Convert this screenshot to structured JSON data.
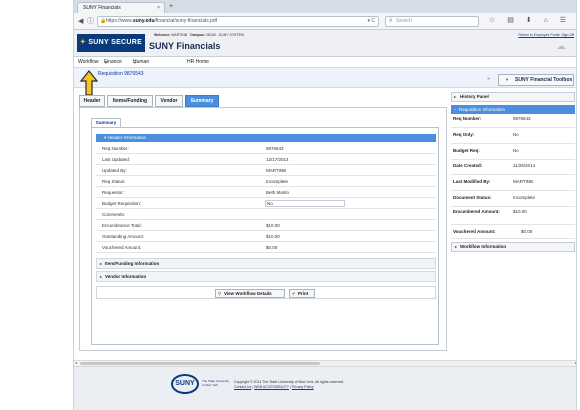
{
  "browser": {
    "tab_title": "SUNY Financials",
    "tab_close": "×",
    "new_tab": "+",
    "url_prefix": "https://www.",
    "url_domain": "suny.edu",
    "url_path": "/financial/suny-financials.pdf",
    "reload_label": "C",
    "search_placeholder": "Search",
    "toolbar_icons": "☆ ▤ ⬇ ⌂ ☰"
  },
  "header": {
    "logo_text": "SUNY SECURE",
    "app_name": "SUNY Financials",
    "welcome_label": "Welcome:",
    "welcome_user": "MARTINB",
    "campus_label": "Campus:",
    "campus_value": "28180 - SUNY SYSTEM",
    "return_link": "Return to Employee Portal",
    "signoff_link": "Sign Off"
  },
  "menu": {
    "workflow": "Workflow",
    "finance": "Finance",
    "human_resources": "Human Resources",
    "hr_home": "HR Home"
  },
  "requisition": {
    "title": "Requisition 9876543",
    "toolbox_label": "SUNY Financial Toolbox"
  },
  "tabs": [
    "Header",
    "Items/Funding",
    "Vendor",
    "Summary"
  ],
  "summary": {
    "tab_label": "Summary",
    "section_header": "Header Information",
    "rows": [
      {
        "label": "Req Number:",
        "value": "9876543"
      },
      {
        "label": "Last Updated:",
        "value": "12/17/2014"
      },
      {
        "label": "Updated By:",
        "value": "MARTINB"
      },
      {
        "label": "Req Status:",
        "value": "Incomplete"
      },
      {
        "label": "Requestor:",
        "value": "Beth Martin"
      },
      {
        "label": "Budget Requisition:",
        "value": "No"
      },
      {
        "label": "Comments:",
        "value": ""
      },
      {
        "label": "Encumbrance Total:",
        "value": "$10.00"
      },
      {
        "label": "Outstanding Amount:",
        "value": "$10.00"
      },
      {
        "label": "Vouchered Amount:",
        "value": "$0.00"
      }
    ],
    "item_funding": "Item/Funding Information",
    "vendor_info": "Vendor Information",
    "view_workflow": "View Workflow Details",
    "print": "Print"
  },
  "right_panel": {
    "history": "History Panel",
    "req_info_header": "Requisition Information",
    "rows": [
      {
        "label": "Req Number:",
        "value": "9876543"
      },
      {
        "label": "Req Only:",
        "value": "No"
      },
      {
        "label": "Budget Req:",
        "value": "No"
      },
      {
        "label": "Date Created:",
        "value": "11/26/2014"
      },
      {
        "label": "Last Modified By:",
        "value": "MARTINB"
      },
      {
        "label": "Document Status:",
        "value": "Incomplete"
      },
      {
        "label": "Encumbered Amount:",
        "value": "$10.00"
      },
      {
        "label": "Vouchered Amount:",
        "value": "$0.00"
      }
    ],
    "workflow_info": "Workflow Information"
  },
  "footer": {
    "logo_text": "SUNY",
    "tagline": "The State University of New York",
    "copyright": "Copyright © 2014 The State University of New York. All rights reserved.",
    "contact": "Contact Us",
    "web_accessibility": "WEB ACCESSIBILITY",
    "privacy": "Privacy Policy"
  }
}
